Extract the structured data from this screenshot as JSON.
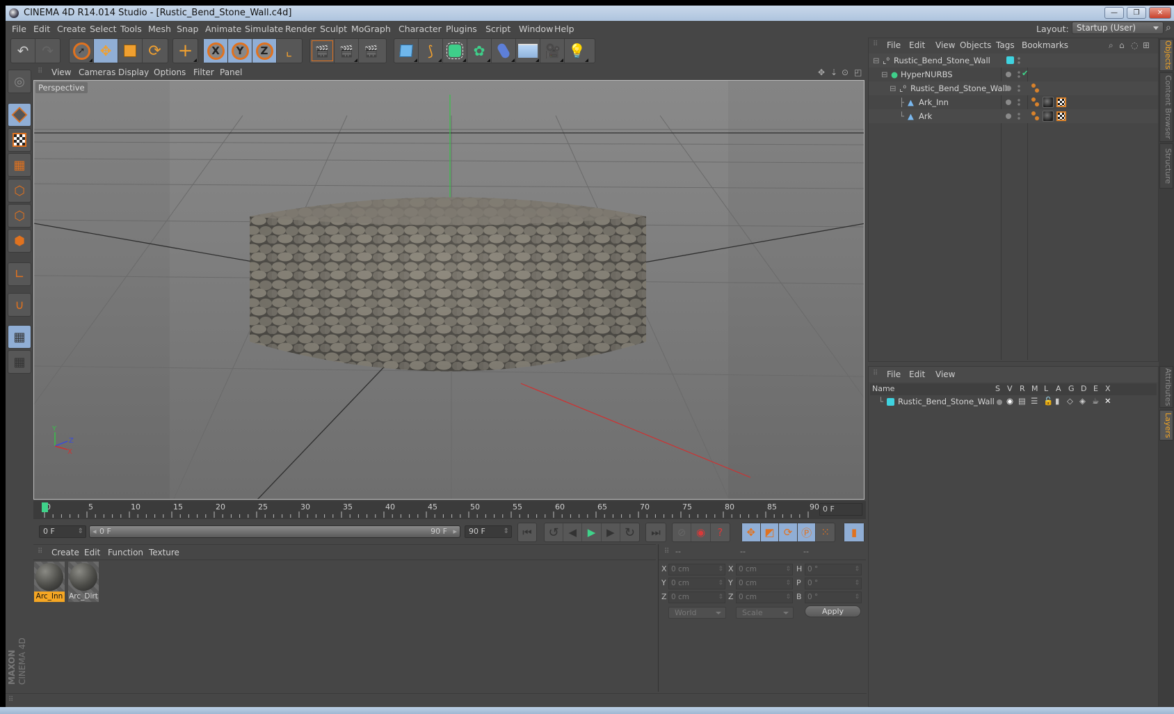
{
  "window": {
    "title": "CINEMA 4D R14.014 Studio - [Rustic_Bend_Stone_Wall.c4d]",
    "controls": [
      "minimize",
      "restore",
      "close"
    ]
  },
  "menubar": {
    "items": [
      "File",
      "Edit",
      "Create",
      "Select",
      "Tools",
      "Mesh",
      "Snap",
      "Animate",
      "Simulate",
      "Render",
      "Sculpt",
      "MoGraph",
      "Character",
      "Plugins",
      "Script",
      "Window",
      "Help"
    ],
    "layout_label": "Layout:",
    "layout_value": "Startup (User)"
  },
  "toolbar": {
    "groups": [
      [
        "undo-icon",
        "redo-icon"
      ],
      [
        "live-selection-icon",
        "move-icon",
        "scale-icon",
        "rotate-icon"
      ],
      [
        "add-object-icon"
      ],
      [
        "x-axis-lock-icon",
        "y-axis-lock-icon",
        "z-axis-lock-icon",
        "coordinate-system-icon"
      ],
      [
        "render-view-icon",
        "render-to-picture-viewer-icon",
        "render-settings-icon"
      ],
      [
        "cube-primitive-icon",
        "spline-pen-icon",
        "subdivision-surface-icon",
        "array-icon",
        "deformer-bend-icon",
        "floor-environment-icon",
        "camera-icon",
        "light-icon"
      ]
    ],
    "axis_labels": [
      "X",
      "Y",
      "Z"
    ]
  },
  "left_tools": [
    "make-editable-icon",
    "model-mode-icon",
    "texture-mode-icon",
    "workplane-mode-icon",
    "points-mode-icon",
    "edges-mode-icon",
    "polygons-mode-icon",
    "axis-mode-icon",
    "magnet-snap-icon",
    "workplane-lock-icon",
    "workplane-align-icon"
  ],
  "viewport": {
    "menu": [
      "View",
      "Cameras",
      "Display",
      "Options",
      "Filter",
      "Panel"
    ],
    "camera_label": "Perspective",
    "nav_icons": [
      "pan-icon",
      "dolly-icon",
      "orbit-icon",
      "maximize-view-icon"
    ],
    "gizmo": {
      "y": "Y",
      "z": "Z",
      "x": "X"
    }
  },
  "timeline": {
    "ticks": [
      "0",
      "5",
      "10",
      "15",
      "20",
      "25",
      "30",
      "35",
      "40",
      "45",
      "50",
      "55",
      "60",
      "65",
      "70",
      "75",
      "80",
      "85",
      "90"
    ],
    "current_frame_field": "0 F",
    "start_field": "0 F",
    "range_start": "0 F",
    "range_end": "90 F",
    "end_field": "90 F",
    "current_frame": 0,
    "max_frame": 90
  },
  "transport": {
    "buttons": [
      "go-to-start-icon",
      "previous-key-icon",
      "previous-frame-icon",
      "play-icon",
      "next-frame-icon",
      "next-key-icon",
      "go-to-end-icon"
    ],
    "record": [
      "autokey-icon",
      "record-active-objects-icon",
      "keyframe-selection-icon"
    ],
    "key_tracks": [
      "position-track-icon",
      "scale-track-icon",
      "rotation-track-icon",
      "parameter-track-icon",
      "pla-track-icon"
    ],
    "timeline_button": "timeline-film-icon"
  },
  "materials": {
    "menu": [
      "Create",
      "Edit",
      "Function",
      "Texture"
    ],
    "items": [
      {
        "name": "Arc_Inn",
        "selected": true
      },
      {
        "name": "Arc_Dirt",
        "selected": false
      }
    ]
  },
  "coordinates": {
    "headers": [
      "--",
      "--",
      "--"
    ],
    "rows": [
      {
        "l1": "X",
        "v1": "0 cm",
        "l2": "X",
        "v2": "0 cm",
        "l3": "H",
        "v3": "0 °"
      },
      {
        "l1": "Y",
        "v1": "0 cm",
        "l2": "Y",
        "v2": "0 cm",
        "l3": "P",
        "v3": "0 °"
      },
      {
        "l1": "Z",
        "v1": "0 cm",
        "l2": "Z",
        "v2": "0 cm",
        "l3": "B",
        "v3": "0 °"
      }
    ],
    "space_select": "World",
    "mode_select": "Scale",
    "apply_label": "Apply"
  },
  "object_manager": {
    "menu": [
      "File",
      "Edit",
      "View",
      "Objects",
      "Tags",
      "Bookmarks"
    ],
    "objects": [
      {
        "name": "Rustic_Bend_Stone_Wall",
        "depth": 0,
        "icon": "null-object-icon",
        "layer_color": "#3fd3e0",
        "tags": []
      },
      {
        "name": "HyperNURBS",
        "depth": 1,
        "icon": "hypernurbs-icon",
        "check": true,
        "tags": []
      },
      {
        "name": "Rustic_Bend_Stone_Wall",
        "depth": 2,
        "icon": "null-object-icon",
        "tags": [
          "phong"
        ]
      },
      {
        "name": "Ark_Inn",
        "depth": 3,
        "icon": "polygon-object-icon",
        "tags": [
          "phong",
          "material",
          "uvw"
        ]
      },
      {
        "name": "Ark",
        "depth": 3,
        "icon": "polygon-object-icon",
        "tags": [
          "phong",
          "material",
          "uvw"
        ]
      }
    ]
  },
  "layer_manager": {
    "menu": [
      "File",
      "Edit",
      "View"
    ],
    "columns": [
      "Name",
      "S",
      "V",
      "R",
      "M",
      "L",
      "A",
      "G",
      "D",
      "E",
      "X"
    ],
    "layers": [
      {
        "name": "Rustic_Bend_Stone_Wall",
        "color": "#3fd3e0"
      }
    ]
  },
  "right_tabs": {
    "top": [
      {
        "label": "Objects",
        "active": true
      },
      {
        "label": "Content Browser",
        "active": false
      },
      {
        "label": "Structure",
        "active": false
      }
    ],
    "bottom": [
      {
        "label": "Attributes",
        "active": false
      },
      {
        "label": "Layers",
        "active": true
      }
    ]
  },
  "branding": {
    "maxon": "MAXON",
    "product": "CINEMA 4D"
  },
  "colors": {
    "accent_orange": "#e0721f",
    "selected_blue": "#90aed5",
    "layer_cyan": "#3fd3e0",
    "highlight_yellow": "#f5a623"
  }
}
